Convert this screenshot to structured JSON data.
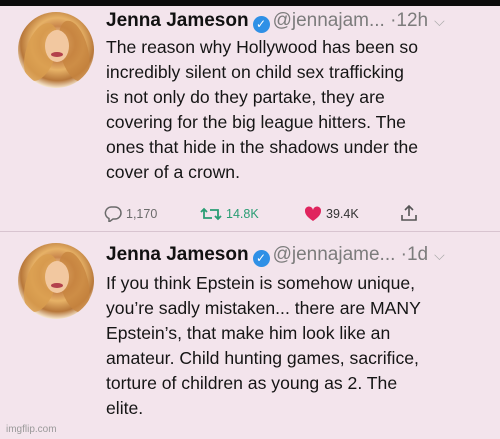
{
  "tweets": [
    {
      "name": "Jenna Jameson",
      "handle": "@jennajam...",
      "time": "·12h",
      "lines": [
        "The reason why Hollywood has been so",
        "incredibly silent on child sex trafficking",
        "is not only do they partake, they are",
        "covering for the big league hitters. The",
        "ones that hide in the shadows under the",
        "cover of a crown."
      ],
      "replies": "1,170",
      "retweets": "14.8K",
      "likes": "39.4K"
    },
    {
      "name": "Jenna Jameson",
      "handle": "@jennajame...",
      "time": "·1d",
      "lines": [
        "If you think Epstein is somehow unique,",
        "you’re sadly mistaken... there are MANY",
        "Epstein’s, that make him look like an",
        "amateur. Child hunting games, sacrifice,",
        "torture of children as young as 2. The",
        "elite."
      ]
    }
  ],
  "icons": {
    "verified": "verified-badge-icon",
    "reply": "speech-bubble-icon",
    "retweet": "retweet-arrows-icon",
    "like": "heart-icon",
    "share": "share-up-arrow-icon",
    "more": "chevron-down-icon"
  },
  "colors": {
    "background": "#f3e4ec",
    "verified": "#2f90e6",
    "retweet": "#2a9d74",
    "like": "#e0245e"
  },
  "watermark": "imgflip.com"
}
